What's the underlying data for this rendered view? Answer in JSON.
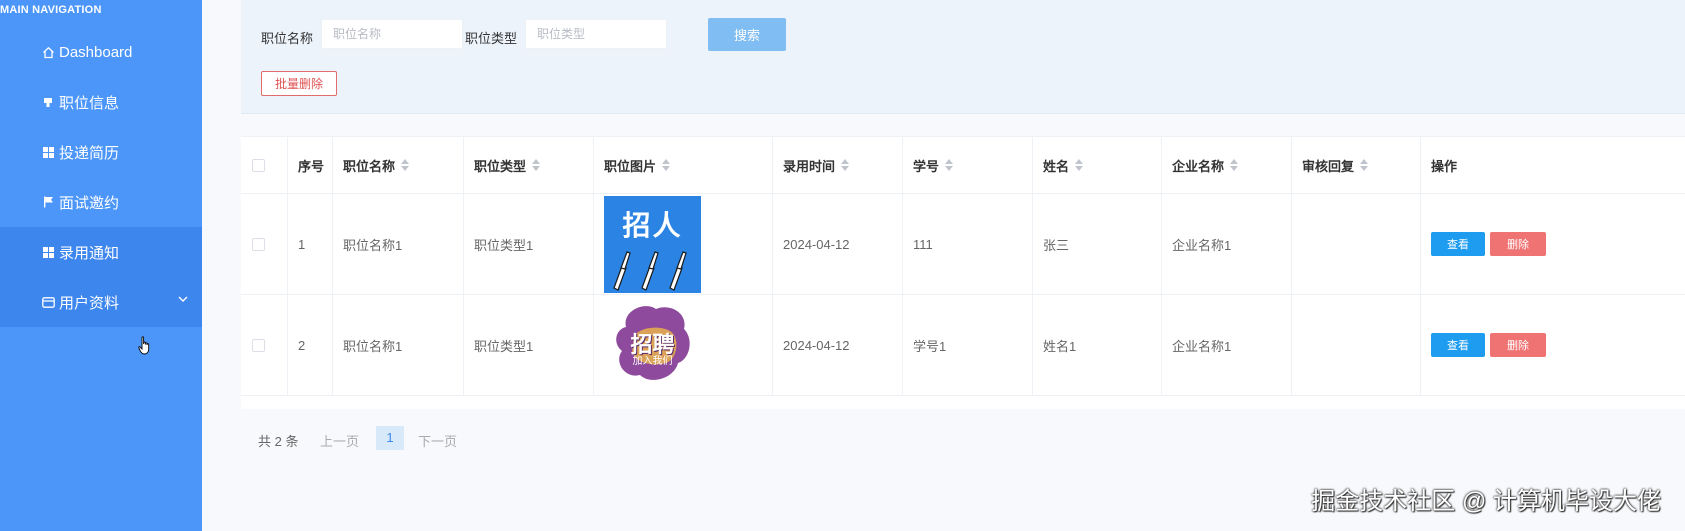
{
  "sidebar": {
    "header": "MAIN NAVIGATION",
    "items": [
      {
        "label": "Dashboard",
        "icon": "home-icon"
      },
      {
        "label": "职位信息",
        "icon": "tag-icon"
      },
      {
        "label": "投递简历",
        "icon": "grid-icon"
      },
      {
        "label": "面试邀约",
        "icon": "flag-icon"
      },
      {
        "label": "录用通知",
        "icon": "grid-icon",
        "active": true
      },
      {
        "label": "用户资料",
        "icon": "card-icon"
      }
    ]
  },
  "search": {
    "job_name_label": "职位名称",
    "job_name_placeholder": "职位名称",
    "job_type_label": "职位类型",
    "job_type_placeholder": "职位类型",
    "search_button": "搜索",
    "batch_delete_button": "批量删除"
  },
  "table": {
    "headers": [
      "序号",
      "职位名称",
      "职位类型",
      "职位图片",
      "录用时间",
      "学号",
      "姓名",
      "企业名称",
      "审核回复",
      "操作"
    ],
    "rows": [
      {
        "index": "1",
        "job_name": "职位名称1",
        "job_type": "职位类型1",
        "image_text": "招人",
        "hire_time": "2024-04-12",
        "student_id": "111",
        "name": "张三",
        "company": "企业名称1",
        "reply": "",
        "view": "查看",
        "delete": "删除"
      },
      {
        "index": "2",
        "job_name": "职位名称1",
        "job_type": "职位类型1",
        "image_text": "招聘",
        "image_subtext": "加入我们",
        "hire_time": "2024-04-12",
        "student_id": "学号1",
        "name": "姓名1",
        "company": "企业名称1",
        "reply": "",
        "view": "查看",
        "delete": "删除"
      }
    ]
  },
  "pagination": {
    "total": "共 2 条",
    "prev": "上一页",
    "current": "1",
    "next": "下一页"
  },
  "watermark": "掘金技术社区 @ 计算机毕设大佬"
}
